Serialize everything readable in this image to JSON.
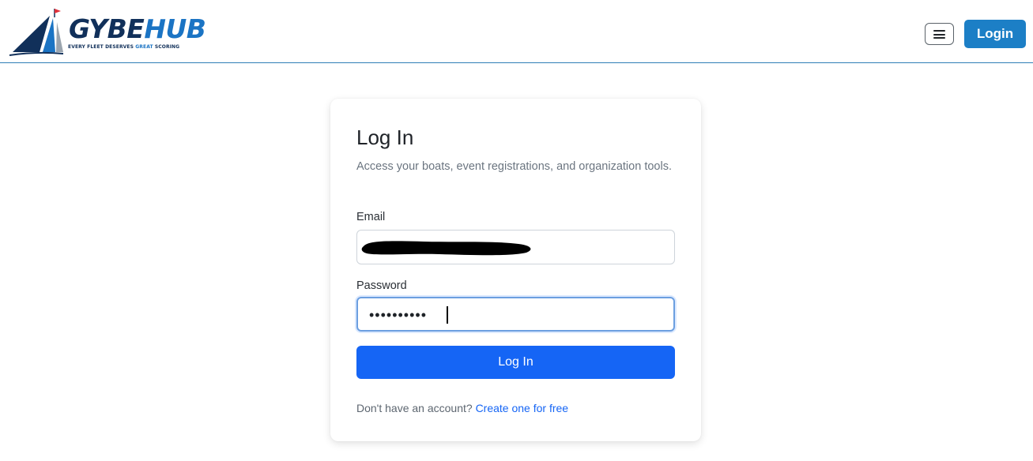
{
  "header": {
    "logo": {
      "word_part1": "GYBE",
      "word_part2": "HUB",
      "tagline_part1": "EVERY FLEET DESERVES ",
      "tagline_highlight": "GREAT",
      "tagline_part2": " SCORING"
    },
    "menu_icon": "hamburger-menu-icon",
    "login_label": "Login"
  },
  "login_card": {
    "title": "Log In",
    "subtitle": "Access your boats, event registrations, and organization tools.",
    "email_label": "Email",
    "email_value_redacted": true,
    "password_label": "Password",
    "password_value": "••••••••••",
    "submit_label": "Log In",
    "signup_prompt": "Don't have an account? ",
    "signup_link": "Create one for free"
  },
  "colors": {
    "brand_navy": "#11305a",
    "brand_blue": "#1b74c4",
    "header_button": "#1c7fc6",
    "primary_button": "#1565f5",
    "logo_flag": "#e0303a"
  }
}
